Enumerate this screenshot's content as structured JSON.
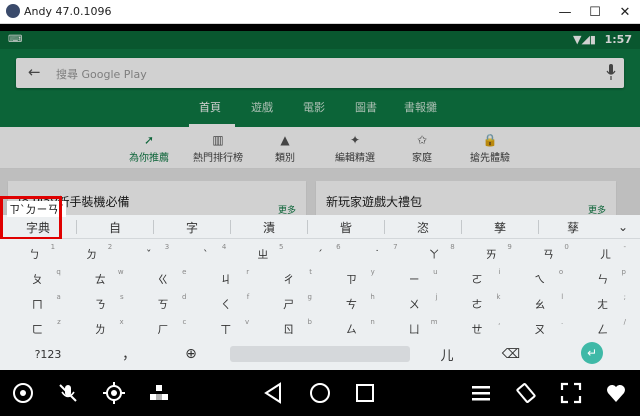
{
  "window": {
    "title": "Andy 47.0.1096",
    "minimize": "—",
    "maximize": "☐",
    "close": "✕"
  },
  "statusbar": {
    "time": "1:57",
    "icons": "▼◢▮",
    "keyboard_icon": "⌨"
  },
  "search": {
    "placeholder": "搜尋 Google Play",
    "back_glyph": "←"
  },
  "top_tabs": [
    "首頁",
    "遊戲",
    "電影",
    "圖書",
    "書報攤"
  ],
  "categories": [
    {
      "label": "為你推薦",
      "icon": "compass-icon",
      "glyph": "➚"
    },
    {
      "label": "熱門排行榜",
      "icon": "chart-icon",
      "glyph": "▥"
    },
    {
      "label": "類別",
      "icon": "shapes-icon",
      "glyph": "▲"
    },
    {
      "label": "編輯精選",
      "icon": "badge-icon",
      "glyph": "✦"
    },
    {
      "label": "家庭",
      "icon": "star-house-icon",
      "glyph": "✩"
    },
    {
      "label": "搶先體驗",
      "icon": "lock-icon",
      "glyph": "🔒"
    }
  ],
  "cards": [
    {
      "title": "le Play新手裝機必備",
      "more": "更多"
    },
    {
      "title": "新玩家遊戲大禮包",
      "more": "更多"
    }
  ],
  "ime": {
    "composing": "ㄗˋㄉㄧㄢˇ",
    "candidates": [
      "字典",
      "自",
      "字",
      "漬",
      "眥",
      "恣",
      "孳",
      "孶"
    ],
    "more_glyph": "⌄"
  },
  "keyboard": {
    "rows": [
      [
        {
          "k": "ㄅ",
          "s": "1"
        },
        {
          "k": "ㄉ",
          "s": "2"
        },
        {
          "k": "ˇ",
          "s": "3"
        },
        {
          "k": "ˋ",
          "s": "4"
        },
        {
          "k": "ㄓ",
          "s": "5"
        },
        {
          "k": "ˊ",
          "s": "6"
        },
        {
          "k": "˙",
          "s": "7"
        },
        {
          "k": "ㄚ",
          "s": "8"
        },
        {
          "k": "ㄞ",
          "s": "9"
        },
        {
          "k": "ㄢ",
          "s": "0"
        },
        {
          "k": "ㄦ",
          "s": "-"
        }
      ],
      [
        {
          "k": "ㄆ",
          "s": "q"
        },
        {
          "k": "ㄊ",
          "s": "w"
        },
        {
          "k": "ㄍ",
          "s": "e"
        },
        {
          "k": "ㄐ",
          "s": "r"
        },
        {
          "k": "ㄔ",
          "s": "t"
        },
        {
          "k": "ㄗ",
          "s": "y"
        },
        {
          "k": "ㄧ",
          "s": "u"
        },
        {
          "k": "ㄛ",
          "s": "i"
        },
        {
          "k": "ㄟ",
          "s": "o"
        },
        {
          "k": "ㄣ",
          "s": "p"
        }
      ],
      [
        {
          "k": "ㄇ",
          "s": "a"
        },
        {
          "k": "ㄋ",
          "s": "s"
        },
        {
          "k": "ㄎ",
          "s": "d"
        },
        {
          "k": "ㄑ",
          "s": "f"
        },
        {
          "k": "ㄕ",
          "s": "g"
        },
        {
          "k": "ㄘ",
          "s": "h"
        },
        {
          "k": "ㄨ",
          "s": "j"
        },
        {
          "k": "ㄜ",
          "s": "k"
        },
        {
          "k": "ㄠ",
          "s": "l"
        },
        {
          "k": "ㄤ",
          "s": ";"
        }
      ],
      [
        {
          "k": "ㄈ",
          "s": "z"
        },
        {
          "k": "ㄌ",
          "s": "x"
        },
        {
          "k": "ㄏ",
          "s": "c"
        },
        {
          "k": "ㄒ",
          "s": "v"
        },
        {
          "k": "ㄖ",
          "s": "b"
        },
        {
          "k": "ㄙ",
          "s": "n"
        },
        {
          "k": "ㄩ",
          "s": "m"
        },
        {
          "k": "ㄝ",
          "s": ","
        },
        {
          "k": "ㄡ",
          "s": "."
        },
        {
          "k": "ㄥ",
          "s": "/"
        }
      ]
    ],
    "bottom": {
      "symbols": "?123",
      "comma": "，",
      "globe": "⊕",
      "space": "",
      "er": "儿",
      "backspace": "⌫",
      "enter": "↵"
    }
  },
  "navbar": {
    "left": [
      "camera-icon",
      "mic-off-icon",
      "locate-icon",
      "apps-icon"
    ],
    "center": [
      "back-icon",
      "home-icon",
      "recents-icon"
    ],
    "right": [
      "menu-icon",
      "rotate-icon",
      "fullscreen-icon",
      "heart-icon"
    ]
  },
  "colors": {
    "play_green": "#0f7a45",
    "status_green": "#0b6b3a",
    "keyboard_bg": "#eceff1",
    "highlight": "#e00000",
    "enter": "#3fb9a7"
  }
}
